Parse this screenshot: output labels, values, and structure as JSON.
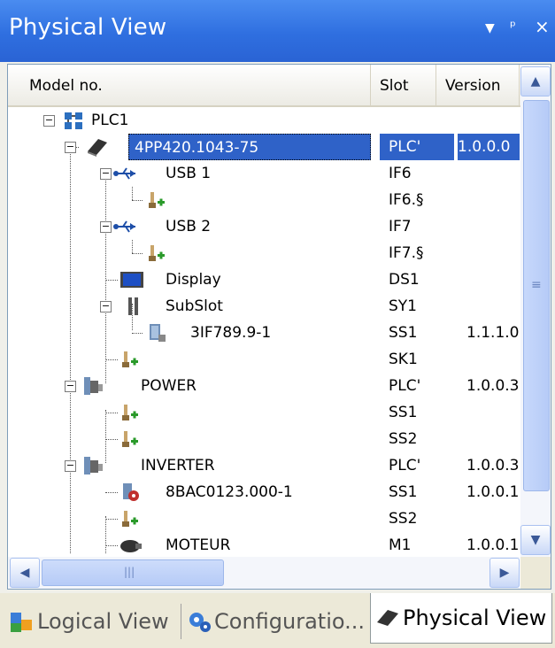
{
  "window": {
    "title": "Physical View",
    "controls": [
      "▾",
      "ᵖ",
      "×"
    ]
  },
  "columns": {
    "model": "Model no.",
    "slot": "Slot",
    "version": "Version"
  },
  "rows": [
    {
      "name": "PLC1",
      "slot": "",
      "version": "",
      "icon": "plc-network-icon"
    },
    {
      "name": "4PP420.1043-75",
      "slot": "PLC'",
      "version": "1.0.0.0",
      "icon": "panel-pc-icon",
      "selected": true
    },
    {
      "name": "USB 1",
      "slot": "IF6",
      "version": "",
      "icon": "usb-icon"
    },
    {
      "name": "",
      "slot": "IF6.§",
      "version": "",
      "icon": "empty-slot-icon"
    },
    {
      "name": "USB 2",
      "slot": "IF7",
      "version": "",
      "icon": "usb-icon"
    },
    {
      "name": "",
      "slot": "IF7.§",
      "version": "",
      "icon": "empty-slot-icon"
    },
    {
      "name": "Display",
      "slot": "DS1",
      "version": "",
      "icon": "display-icon"
    },
    {
      "name": "SubSlot",
      "slot": "SY1",
      "version": "",
      "icon": "subslot-icon"
    },
    {
      "name": "3IF789.9-1",
      "slot": "SS1",
      "version": "1.1.1.0",
      "icon": "module-icon"
    },
    {
      "name": "",
      "slot": "SK1",
      "version": "",
      "icon": "empty-slot-icon"
    },
    {
      "name": "POWER",
      "slot": "PLC'",
      "version": "1.0.0.3",
      "icon": "power-module-icon"
    },
    {
      "name": "",
      "slot": "SS1",
      "version": "",
      "icon": "empty-slot-icon"
    },
    {
      "name": "",
      "slot": "SS2",
      "version": "",
      "icon": "empty-slot-icon"
    },
    {
      "name": "INVERTER",
      "slot": "PLC'",
      "version": "1.0.0.3",
      "icon": "inverter-module-icon"
    },
    {
      "name": "8BAC0123.000-1",
      "slot": "SS1",
      "version": "1.0.0.1",
      "icon": "plugin-card-icon"
    },
    {
      "name": "",
      "slot": "SS2",
      "version": "",
      "icon": "empty-slot-icon"
    },
    {
      "name": "MOTEUR",
      "slot": "M1",
      "version": "1.0.0.1",
      "icon": "motor-icon"
    }
  ],
  "scrollbars": {
    "up": "▲",
    "down": "▼",
    "left": "◀",
    "right": "▶",
    "grip": "≡",
    "hgrip": "|||"
  },
  "tabs": [
    {
      "label": "Logical View",
      "icon": "logical-view-icon",
      "active": false
    },
    {
      "label": "Configuratio...",
      "icon": "configuration-icon",
      "active": false
    },
    {
      "label": "Physical View",
      "icon": "physical-view-icon",
      "active": true
    }
  ],
  "colors": {
    "titlebar": "#2f6fe0",
    "selection": "#2f62c8"
  }
}
